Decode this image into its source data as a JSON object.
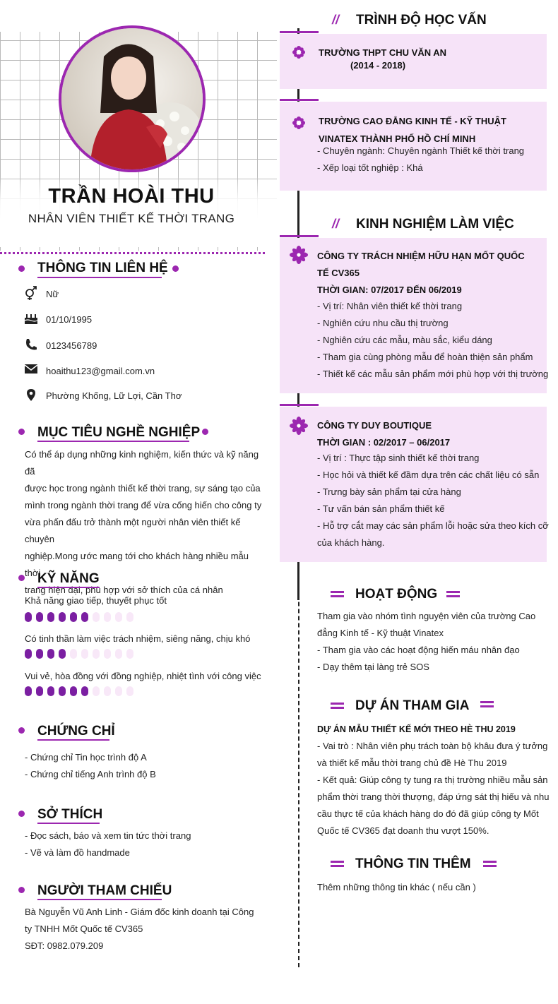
{
  "profile": {
    "name": "TRẦN HOÀI THU",
    "job_title": "NHÂN VIÊN THIẾT KẾ THỜI TRANG"
  },
  "contact": {
    "title": "THÔNG TIN LIÊN HỆ",
    "gender": "Nữ",
    "birthday": "01/10/1995",
    "phone": "0123456789",
    "email": "hoaithu123@gmail.com.vn",
    "address": "Phường Khống, Lữ Lợi, Cần Thơ"
  },
  "objective": {
    "title": "MỤC TIÊU NGHỀ NGHIỆP",
    "lines": [
      "Có thể áp dụng những kinh nghiệm, kiến thức và kỹ năng đã",
      "được học trong ngành thiết kế thời trang, sự sáng tạo của",
      "mình trong ngành thời trang để vừa cống hiến cho công ty",
      "vừa phấn đấu trở thành một người nhân viên thiết kế chuyên",
      "nghiệp.Mong ước mang tới cho khách hàng nhiều mẫu thời",
      "trang hiện đại, phù hợp với sở thích của cá nhân"
    ]
  },
  "skills": {
    "title": "KỸ NĂNG",
    "items": [
      {
        "label": "Khả năng giao tiếp, thuyết phục tốt",
        "level": 6,
        "max": 10
      },
      {
        "label": "Có tinh thần làm việc trách nhiệm, siêng năng, chịu khó",
        "level": 4,
        "max": 10
      },
      {
        "label": "Vui vẻ, hòa đồng với đồng nghiệp, nhiệt tình với công việc",
        "level": 6,
        "max": 10
      }
    ]
  },
  "certificates": {
    "title": "CHỨNG CHỈ",
    "items": [
      "- Chứng chỉ Tin học trình độ A",
      "- Chứng chỉ tiếng Anh trình độ B"
    ]
  },
  "hobbies": {
    "title": "SỞ THÍCH",
    "items": [
      "- Đọc sách, báo và xem tin tức thời trang",
      "- Vẽ và làm đồ handmade"
    ]
  },
  "references": {
    "title": "NGƯỜI THAM CHIẾU",
    "lines": [
      "Bà Nguyễn Vũ Anh Linh - Giám đốc kinh doanh tại Công",
      "ty TNHH Mốt Quốc tế CV365",
      "SĐT: 0982.079.209"
    ]
  },
  "education": {
    "title": "TRÌNH ĐỘ HỌC VẤN",
    "school1": {
      "name": "TRƯỜNG THPT CHU VĂN AN",
      "years": "(2014 - 2018)"
    },
    "school2": {
      "name_line1": "TRƯỜNG CAO ĐẲNG KINH TẾ - KỸ THUẬT",
      "name_line2": "VINATEX THÀNH PHỐ HỒ CHÍ MINH",
      "details": [
        "- Chuyên ngành: Chuyên ngành Thiết kế thời trang",
        "- Xếp loại tốt nghiệp : Khá"
      ]
    }
  },
  "experience": {
    "title": "KINH NGHIỆM LÀM VIỆC",
    "job1": {
      "company_line1": "CÔNG TY TRÁCH NHIỆM HỮU HẠN MỐT QUỐC",
      "company_line2": "TẾ CV365",
      "period": "THỜI GIAN: 07/2017 ĐẾN 06/2019",
      "details": [
        "- Vị trí: Nhân viên thiết kế thời trang",
        "- Nghiên cứu nhu cầu thị trường",
        "- Nghiên cứu các mẫu, màu sắc, kiểu dáng",
        "- Tham gia cùng phòng mẫu để hoàn thiện sản phẩm",
        "- Thiết kế các mẫu sản phẩm mới phù hợp với thị trường"
      ]
    },
    "job2": {
      "company": "CÔNG TY DUY BOUTIQUE",
      "period": "THỜI GIAN : 02/2017 – 06/2017",
      "details": [
        "- Vị trí : Thực tập sinh thiết kế thời trang",
        "- Học hỏi và thiết kế đầm dựa trên các chất liệu có sẵn",
        "- Trưng bày sản phẩm tại cửa hàng",
        "- Tư vấn bán sản phẩm thiết kế",
        "- Hỗ trợ cắt may các sản phẩm lỗi hoặc sửa theo kích cỡ",
        "của khách hàng."
      ]
    }
  },
  "activities": {
    "title": "HOẠT ĐỘNG",
    "lines": [
      "Tham gia vào nhóm tình nguyện viên của trường Cao",
      "đẳng Kinh tế - Kỹ thuật Vinatex",
      "- Tham gia vào các hoạt động hiến máu nhân đạo",
      "- Dạy thêm tại làng trẻ SOS"
    ]
  },
  "projects": {
    "title": "DỰ ÁN THAM GIA",
    "name": "DỰ ÁN MẪU THIẾT KẾ MỚI THEO HÈ THU 2019",
    "lines": [
      "- Vai trò : Nhân viên phụ trách toàn bộ khâu đưa ý tưởng",
      "và thiết kế mẫu thời trang chủ đề Hè Thu 2019",
      "- Kết quả: Giúp công ty tung ra thị trường nhiều mẫu sản",
      "phẩm thời trang thời thượng, đáp ứng sát thị hiếu và nhu",
      "cầu thực tế của khách hàng do đó đã giúp công ty Mốt",
      "Quốc tế CV365 đạt doanh thu vượt 150%."
    ]
  },
  "extra": {
    "title": "THÔNG TIN THÊM",
    "text": "Thêm những thông tin khác ( nếu cần )"
  },
  "colors": {
    "accent": "#9c27b0",
    "box": "#f6e3f8",
    "pill_off": "#f8e8f8"
  },
  "icons": [
    "gender-icon",
    "cake-icon",
    "phone-icon",
    "mail-icon",
    "location-icon",
    "flower-icon"
  ]
}
